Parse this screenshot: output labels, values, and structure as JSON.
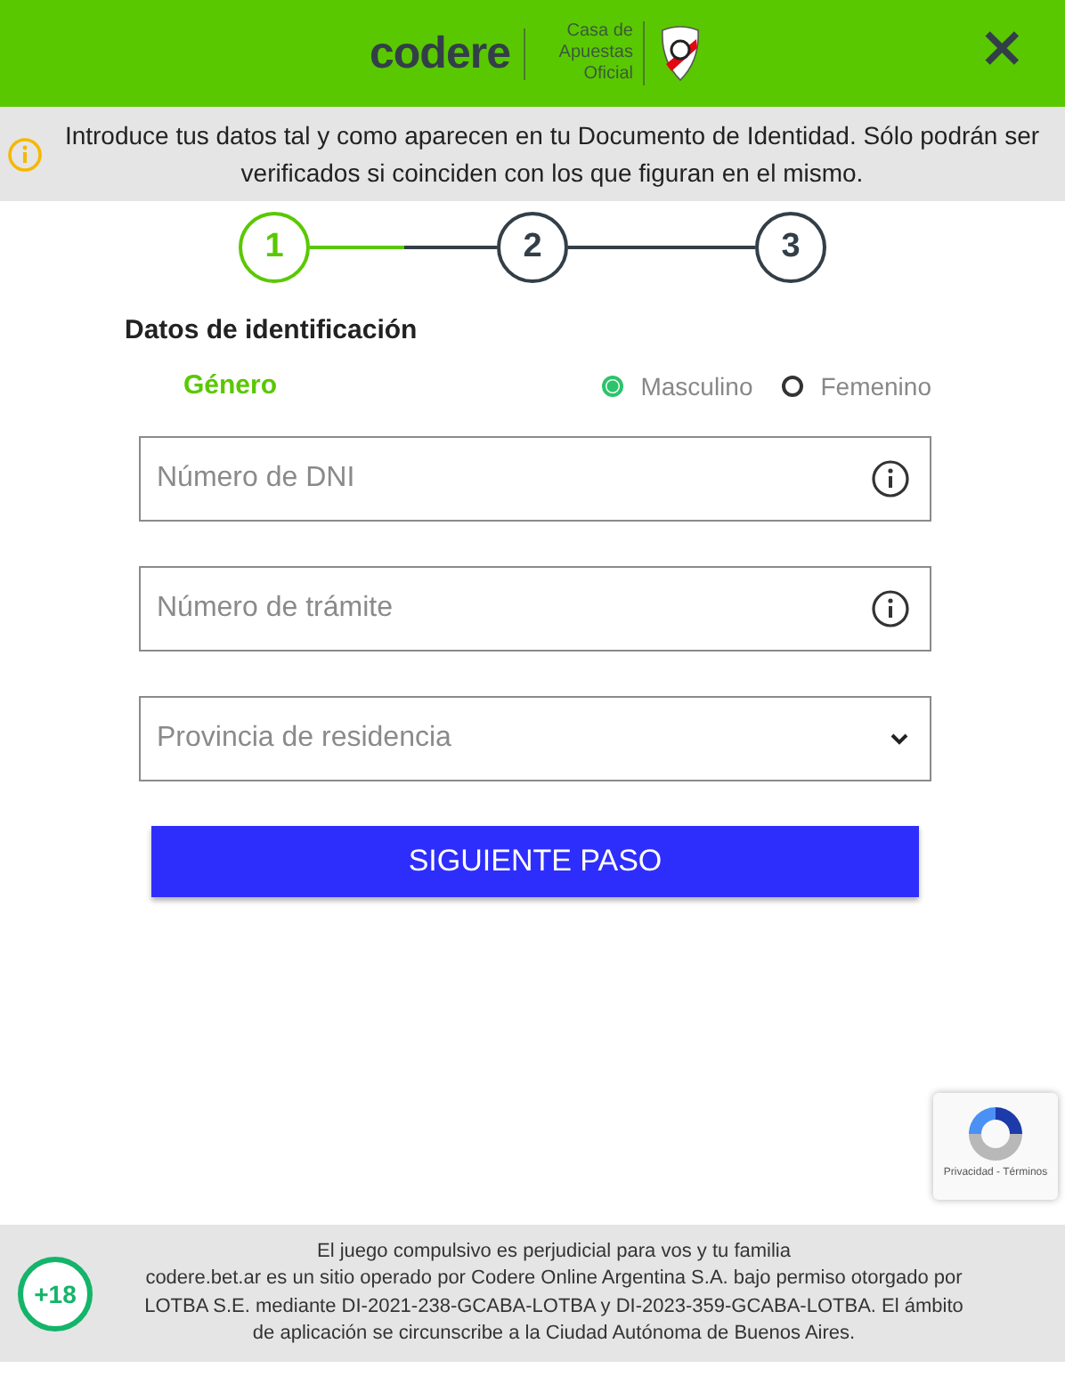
{
  "header": {
    "logo": "codere",
    "tagline": "Casa de Apuestas Oficial",
    "close": "×"
  },
  "notice": {
    "text": "Introduce tus datos tal y como aparecen en tu Documento de Identidad. Sólo podrán ser verificados si coinciden con los que figuran en el mismo."
  },
  "steps": [
    {
      "label": "1",
      "selected": true
    },
    {
      "label": "2",
      "selected": false
    },
    {
      "label": "3",
      "selected": false
    }
  ],
  "section_title": "Datos de identificación",
  "gender": {
    "label": "Género",
    "options": [
      {
        "label": "Masculino",
        "selected": true
      },
      {
        "label": "Femenino",
        "selected": false
      }
    ]
  },
  "fields": [
    {
      "kind": "input",
      "placeholder": "Número de DNI"
    },
    {
      "kind": "input",
      "placeholder": "Número de trámite"
    },
    {
      "kind": "select",
      "placeholder": "Provincia de residencia"
    }
  ],
  "next_button": "SIGUIENTE PASO",
  "recaptcha": {
    "links": "Privacidad - Términos"
  },
  "footer": {
    "age_badge": "+18",
    "warning": "El juego compulsivo es perjudicial para vos y tu familia",
    "legal": "codere.bet.ar es un sitio operado por Codere Online Argentina S.A. bajo permiso otorgado por LOTBA S.E. mediante DI-2021-238-GCABA-LOTBA y DI-2023-359-GCABA-LOTBA. El ámbito de aplicación se circunscribe a la Ciudad Autónoma de Buenos Aires."
  }
}
